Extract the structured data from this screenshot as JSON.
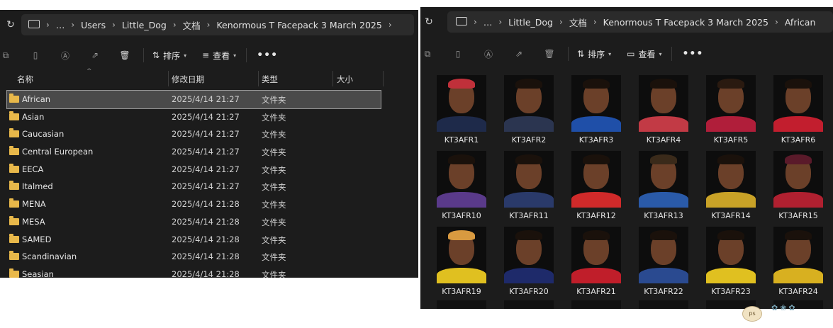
{
  "left_window": {
    "refresh_icon": "refresh-icon",
    "breadcrumb": [
      "…",
      "Users",
      "Little_Dog",
      "文档",
      "Kenormous T Facepack 3 March 2025"
    ],
    "toolbar": {
      "sort_label": "排序",
      "view_label": "查看",
      "more_label": "•••"
    },
    "columns": {
      "name": "名称",
      "date": "修改日期",
      "type": "类型",
      "size": "大小"
    },
    "rows": [
      {
        "name": "African",
        "date": "2025/4/14 21:27",
        "type": "文件夹"
      },
      {
        "name": "Asian",
        "date": "2025/4/14 21:27",
        "type": "文件夹"
      },
      {
        "name": "Caucasian",
        "date": "2025/4/14 21:27",
        "type": "文件夹"
      },
      {
        "name": "Central European",
        "date": "2025/4/14 21:27",
        "type": "文件夹"
      },
      {
        "name": "EECA",
        "date": "2025/4/14 21:27",
        "type": "文件夹"
      },
      {
        "name": "Italmed",
        "date": "2025/4/14 21:27",
        "type": "文件夹"
      },
      {
        "name": "MENA",
        "date": "2025/4/14 21:28",
        "type": "文件夹"
      },
      {
        "name": "MESA",
        "date": "2025/4/14 21:28",
        "type": "文件夹"
      },
      {
        "name": "SAMED",
        "date": "2025/4/14 21:28",
        "type": "文件夹"
      },
      {
        "name": "Scandinavian",
        "date": "2025/4/14 21:28",
        "type": "文件夹"
      },
      {
        "name": "Seasian",
        "date": "2025/4/14 21:28",
        "type": "文件夹"
      }
    ]
  },
  "right_window": {
    "breadcrumb": [
      "…",
      "Little_Dog",
      "文档",
      "Kenormous T Facepack 3 March 2025",
      "African"
    ],
    "toolbar": {
      "sort_label": "排序",
      "view_label": "查看",
      "more_label": "•••"
    },
    "tiles": [
      {
        "label": "KT3AFR1",
        "shirt": "#1e2a4a",
        "hair": "#c0303a"
      },
      {
        "label": "KT3AFR2",
        "shirt": "#2b3550",
        "hair": "#1a110b"
      },
      {
        "label": "KT3AFR3",
        "shirt": "#1f4fa8",
        "hair": "#1a110b"
      },
      {
        "label": "KT3AFR4",
        "shirt": "#c23a45",
        "hair": "#1a110b"
      },
      {
        "label": "KT3AFR5",
        "shirt": "#b01e3a",
        "hair": "#2a1a10"
      },
      {
        "label": "KT3AFR6",
        "shirt": "#c21e2e",
        "hair": "#1a110b"
      },
      {
        "label": "KT3AFR10",
        "shirt": "#5a3a8a",
        "hair": "#1a110b"
      },
      {
        "label": "KT3AFR11",
        "shirt": "#2a3a6a",
        "hair": "#1a110b"
      },
      {
        "label": "KT3AFR12",
        "shirt": "#d02a2a",
        "hair": "#1a110b"
      },
      {
        "label": "KT3AFR13",
        "shirt": "#2a5aa8",
        "hair": "#3a2a1a"
      },
      {
        "label": "KT3AFR14",
        "shirt": "#c9a227",
        "hair": "#1a110b"
      },
      {
        "label": "KT3AFR15",
        "shirt": "#b02030",
        "hair": "#5a1a2a"
      },
      {
        "label": "KT3AFR19",
        "shirt": "#e0c020",
        "hair": "#d89a40"
      },
      {
        "label": "KT3AFR20",
        "shirt": "#1e2a6a",
        "hair": "#1a110b"
      },
      {
        "label": "KT3AFR21",
        "shirt": "#c01e2a",
        "hair": "#1a110b"
      },
      {
        "label": "KT3AFR22",
        "shirt": "#2a4a90",
        "hair": "#1a110b"
      },
      {
        "label": "KT3AFR23",
        "shirt": "#e0c020",
        "hair": "#1a110b"
      },
      {
        "label": "KT3AFR24",
        "shirt": "#d8b020",
        "hair": "#1a110b"
      }
    ]
  }
}
